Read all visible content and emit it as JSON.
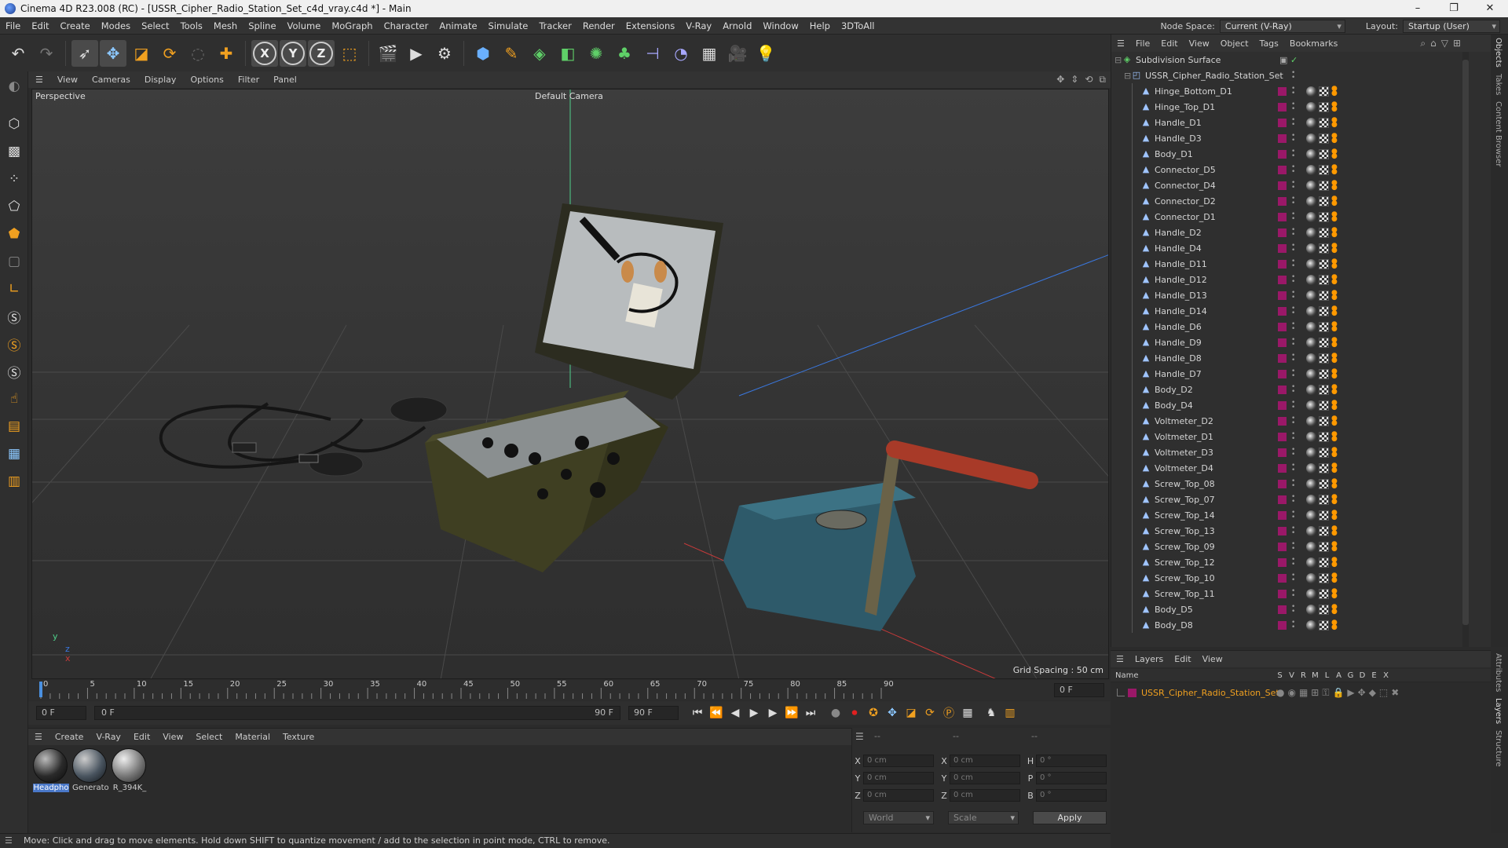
{
  "window": {
    "title": "Cinema 4D R23.008 (RC) - [USSR_Cipher_Radio_Station_Set_c4d_vray.c4d *] - Main",
    "minimize": "–",
    "maximize": "❐",
    "close": "✕"
  },
  "menu": [
    "File",
    "Edit",
    "Create",
    "Modes",
    "Select",
    "Tools",
    "Mesh",
    "Spline",
    "Volume",
    "MoGraph",
    "Character",
    "Animate",
    "Simulate",
    "Tracker",
    "Render",
    "Extensions",
    "V-Ray",
    "Arnold",
    "Window",
    "Help",
    "3DToAll"
  ],
  "node_space": {
    "label": "Node Space:",
    "value": "Current (V-Ray)"
  },
  "layout": {
    "label": "Layout:",
    "value": "Startup (User)"
  },
  "viewport_menu": [
    "View",
    "Cameras",
    "Display",
    "Options",
    "Filter",
    "Panel"
  ],
  "viewport": {
    "name": "Perspective",
    "camera": "Default Camera",
    "grid_spacing": "Grid Spacing : 50 cm"
  },
  "timeline": {
    "ticks": [
      "0",
      "5",
      "10",
      "15",
      "20",
      "25",
      "30",
      "35",
      "40",
      "45",
      "50",
      "55",
      "60",
      "65",
      "70",
      "75",
      "80",
      "85",
      "90"
    ],
    "current_frame": "0 F",
    "start_field": "0 F",
    "range_start": "0 F",
    "range_end": "90 F",
    "end_field": "90 F"
  },
  "material_menu": [
    "Create",
    "V-Ray",
    "Edit",
    "View",
    "Select",
    "Material",
    "Texture"
  ],
  "materials": [
    {
      "label": "Headpho",
      "color": "#3a3a3a"
    },
    {
      "label": "Generato",
      "color": "#4a5560"
    },
    {
      "label": "R_394K_",
      "color": "#777777"
    }
  ],
  "coordinates": {
    "header": [
      "--",
      "--",
      "--"
    ],
    "rows": [
      {
        "a": "X",
        "av": "0 cm",
        "b": "X",
        "bv": "0 cm",
        "c": "H",
        "cv": "0 °"
      },
      {
        "a": "Y",
        "av": "0 cm",
        "b": "Y",
        "bv": "0 cm",
        "c": "P",
        "cv": "0 °"
      },
      {
        "a": "Z",
        "av": "0 cm",
        "b": "Z",
        "bv": "0 cm",
        "c": "B",
        "cv": "0 °"
      }
    ],
    "world": "World",
    "scale": "Scale",
    "apply": "Apply"
  },
  "status": "Move: Click and drag to move elements. Hold down SHIFT to quantize movement / add to the selection in point mode, CTRL to remove.",
  "object_menu": [
    "File",
    "Edit",
    "View",
    "Object",
    "Tags",
    "Bookmarks"
  ],
  "objects": {
    "root": "Subdivision Surface",
    "group": "USSR_Cipher_Radio_Station_Set",
    "items": [
      "Hinge_Bottom_D1",
      "Hinge_Top_D1",
      "Handle_D1",
      "Handle_D3",
      "Body_D1",
      "Connector_D5",
      "Connector_D4",
      "Connector_D2",
      "Connector_D1",
      "Handle_D2",
      "Handle_D4",
      "Handle_D11",
      "Handle_D12",
      "Handle_D13",
      "Handle_D14",
      "Handle_D6",
      "Handle_D9",
      "Handle_D8",
      "Handle_D7",
      "Body_D2",
      "Body_D4",
      "Voltmeter_D2",
      "Voltmeter_D1",
      "Voltmeter_D3",
      "Voltmeter_D4",
      "Screw_Top_08",
      "Screw_Top_07",
      "Screw_Top_14",
      "Screw_Top_13",
      "Screw_Top_09",
      "Screw_Top_12",
      "Screw_Top_10",
      "Screw_Top_11",
      "Body_D5",
      "Body_D8"
    ]
  },
  "layers_menu": [
    "Layers",
    "Edit",
    "View"
  ],
  "layers_header": {
    "name": "Name",
    "cols": [
      "S",
      "V",
      "R",
      "M",
      "L",
      "A",
      "G",
      "D",
      "E",
      "X"
    ]
  },
  "layers": [
    {
      "name": "USSR_Cipher_Radio_Station_Set",
      "color": "#9a1868"
    }
  ],
  "right_tabs_top": [
    "Objects",
    "Takes",
    "Content Browser"
  ],
  "right_tabs_bottom": [
    "Attributes",
    "Layers",
    "Structure"
  ],
  "colors": {
    "accent": "#f0a020",
    "layer": "#9a1868",
    "selection": "#4a78c8"
  }
}
